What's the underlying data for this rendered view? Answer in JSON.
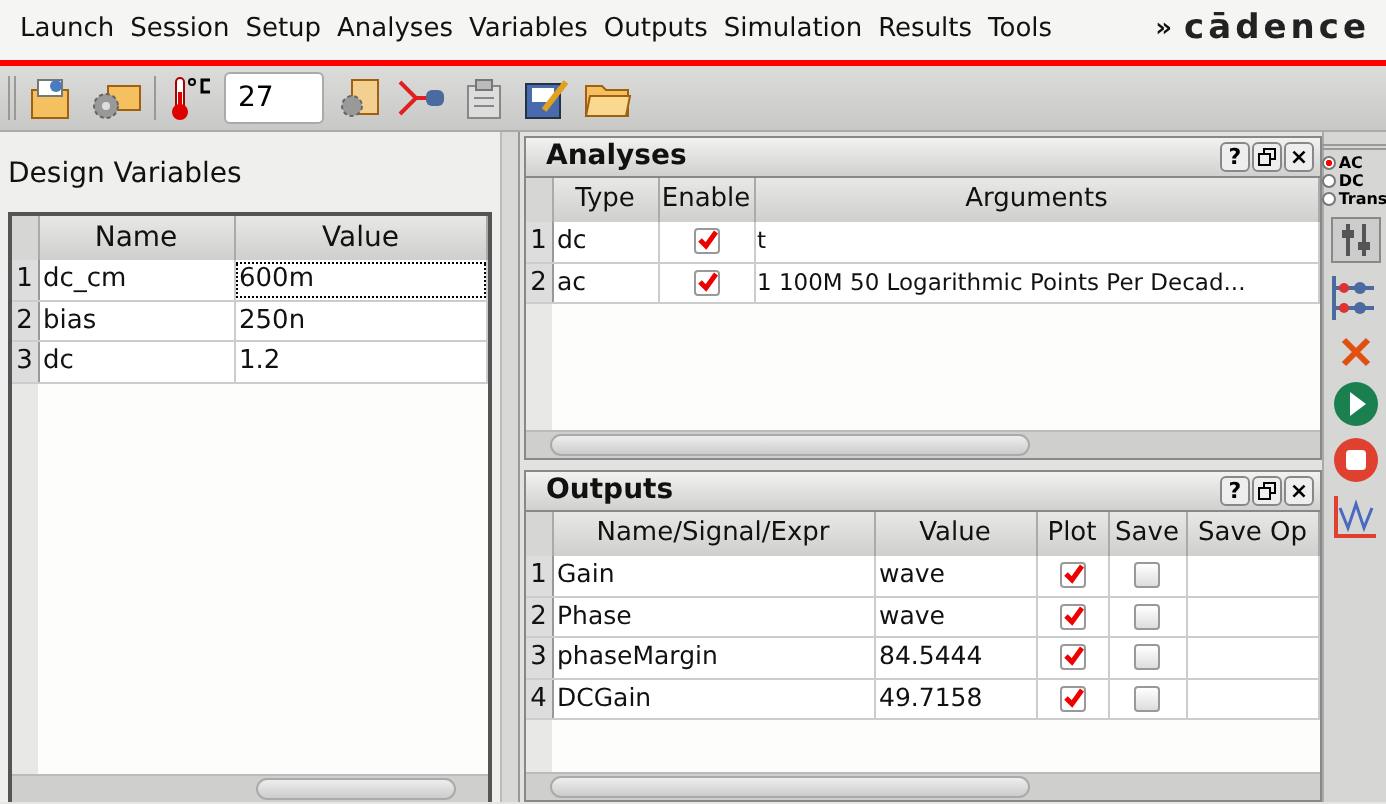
{
  "menu": [
    {
      "label": "Launch"
    },
    {
      "label": "Session"
    },
    {
      "label": "Setup"
    },
    {
      "label": "Analyses"
    },
    {
      "label": "Variables"
    },
    {
      "label": "Outputs"
    },
    {
      "label": "Simulation"
    },
    {
      "label": "Results"
    },
    {
      "label": "Tools"
    }
  ],
  "logo": {
    "chevron": "»",
    "text": "cādence"
  },
  "toolbar": {
    "temperature": "27"
  },
  "design_variables": {
    "title": "Design Variables",
    "columns": [
      "Name",
      "Value"
    ],
    "rows": [
      {
        "index": "1",
        "name": "dc_cm",
        "value": "600m",
        "focused": true
      },
      {
        "index": "2",
        "name": "bias",
        "value": "250n",
        "focused": false
      },
      {
        "index": "3",
        "name": "dc",
        "value": "1.2",
        "focused": false
      }
    ]
  },
  "analyses": {
    "title": "Analyses",
    "buttons": [
      {
        "kind": "help",
        "label": "?"
      },
      {
        "kind": "float"
      },
      {
        "kind": "close",
        "label": "×"
      }
    ],
    "columns": [
      "Type",
      "Enable",
      "Arguments"
    ],
    "rows": [
      {
        "index": "1",
        "type": "dc",
        "enabled": true,
        "arguments": "t"
      },
      {
        "index": "2",
        "type": "ac",
        "enabled": true,
        "arguments": "1 100M 50 Logarithmic Points Per Decad..."
      }
    ]
  },
  "outputs": {
    "title": "Outputs",
    "buttons": [
      {
        "kind": "help",
        "label": "?"
      },
      {
        "kind": "float"
      },
      {
        "kind": "close",
        "label": "×"
      }
    ],
    "columns": [
      "Name/Signal/Expr",
      "Value",
      "Plot",
      "Save",
      "Save Op"
    ],
    "rows": [
      {
        "index": "1",
        "name": "Gain",
        "value": "wave",
        "plot": true,
        "save": false
      },
      {
        "index": "2",
        "name": "Phase",
        "value": "wave",
        "plot": true,
        "save": false
      },
      {
        "index": "3",
        "name": "phaseMargin",
        "value": "84.5444",
        "plot": true,
        "save": false
      },
      {
        "index": "4",
        "name": "DCGain",
        "value": "49.7158",
        "plot": true,
        "save": false
      }
    ]
  },
  "analysis_types": [
    {
      "label": "AC",
      "selected": true
    },
    {
      "label": "DC",
      "selected": false
    },
    {
      "label": "Trans",
      "selected": false
    }
  ]
}
